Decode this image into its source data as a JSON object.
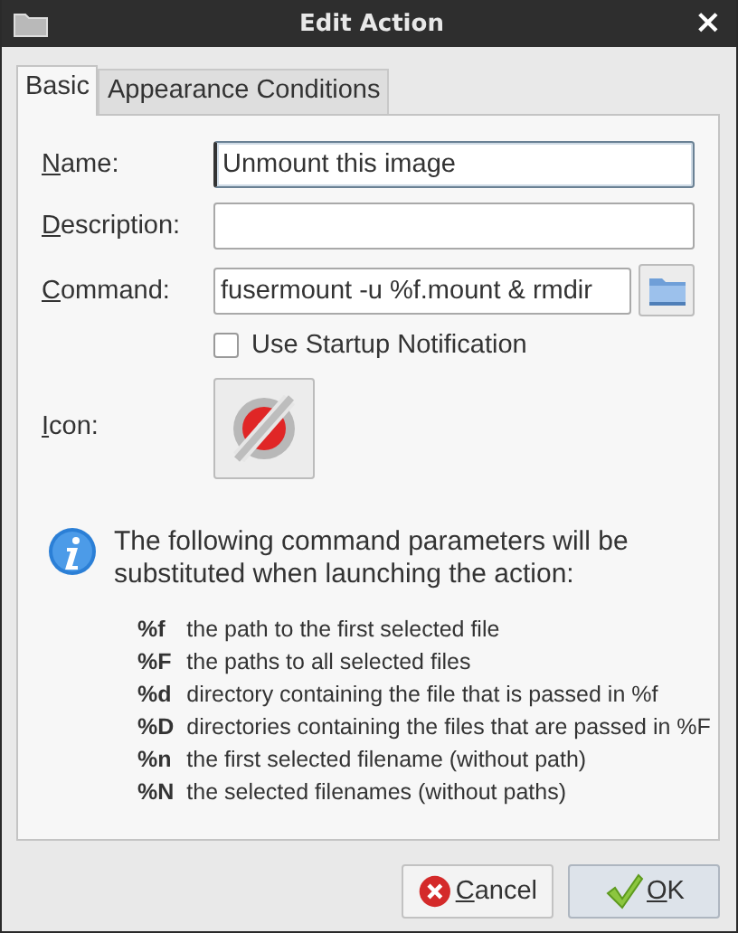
{
  "window": {
    "title": "Edit Action",
    "close": "×"
  },
  "tabs": [
    {
      "label": "Basic",
      "selected": true
    },
    {
      "label": "Appearance Conditions",
      "selected": false
    }
  ],
  "fields": [
    {
      "label": "Name:",
      "value": "Unmount this image",
      "focused": true
    },
    {
      "label": "Description:",
      "focused": false
    },
    {
      "label": "Command:",
      "value": "fusermount -u %f.mount & rmdir",
      "focused": false
    }
  ],
  "startup_notification": {
    "label": "Use Startup Notification",
    "checked": false
  },
  "icon": {
    "label": "Icon:"
  },
  "info": {
    "text": "The following command parameters will be substituted when launching the action:",
    "parameters": [
      {
        "code": "%f",
        "meaning": "the path to the first selected file"
      },
      {
        "code": "%F",
        "meaning": "the paths to all selected files"
      },
      {
        "code": "%d",
        "meaning": "directory containing the file that is passed in %f"
      },
      {
        "code": "%D",
        "meaning": "directories containing the files that are passed in %F"
      },
      {
        "code": "%n",
        "meaning": "the first selected filename (without path)"
      },
      {
        "code": "%N",
        "meaning": "the selected filenames (without paths)"
      }
    ]
  },
  "buttons": [
    {
      "label": "Cancel",
      "kind": "cancel",
      "default": false
    },
    {
      "label": "OK",
      "kind": "ok",
      "default": true
    }
  ]
}
